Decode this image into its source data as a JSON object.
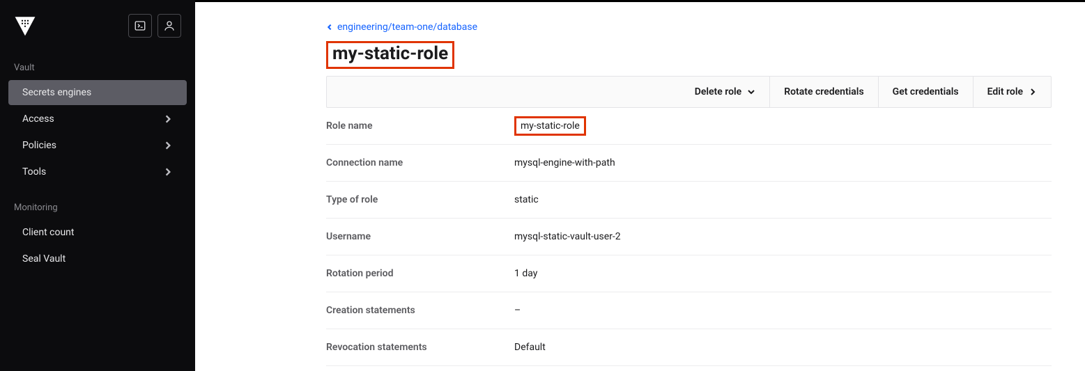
{
  "sidebar": {
    "section1_label": "Vault",
    "items1": [
      {
        "label": "Secrets engines",
        "active": true,
        "chevron": false
      },
      {
        "label": "Access",
        "active": false,
        "chevron": true
      },
      {
        "label": "Policies",
        "active": false,
        "chevron": true
      },
      {
        "label": "Tools",
        "active": false,
        "chevron": true
      }
    ],
    "section2_label": "Monitoring",
    "items2": [
      {
        "label": "Client count",
        "active": false,
        "chevron": false
      },
      {
        "label": "Seal Vault",
        "active": false,
        "chevron": false
      }
    ]
  },
  "breadcrumb": {
    "path": "engineering/team-one/database"
  },
  "page_title": "my-static-role",
  "toolbar": {
    "delete_role": "Delete role",
    "rotate": "Rotate credentials",
    "get": "Get credentials",
    "edit": "Edit role"
  },
  "details": [
    {
      "label": "Role name",
      "value": "my-static-role",
      "highlight": true
    },
    {
      "label": "Connection name",
      "value": "mysql-engine-with-path"
    },
    {
      "label": "Type of role",
      "value": "static"
    },
    {
      "label": "Username",
      "value": "mysql-static-vault-user-2"
    },
    {
      "label": "Rotation period",
      "value": "1 day"
    },
    {
      "label": "Creation statements",
      "value": "–"
    },
    {
      "label": "Revocation statements",
      "value": "Default"
    }
  ]
}
